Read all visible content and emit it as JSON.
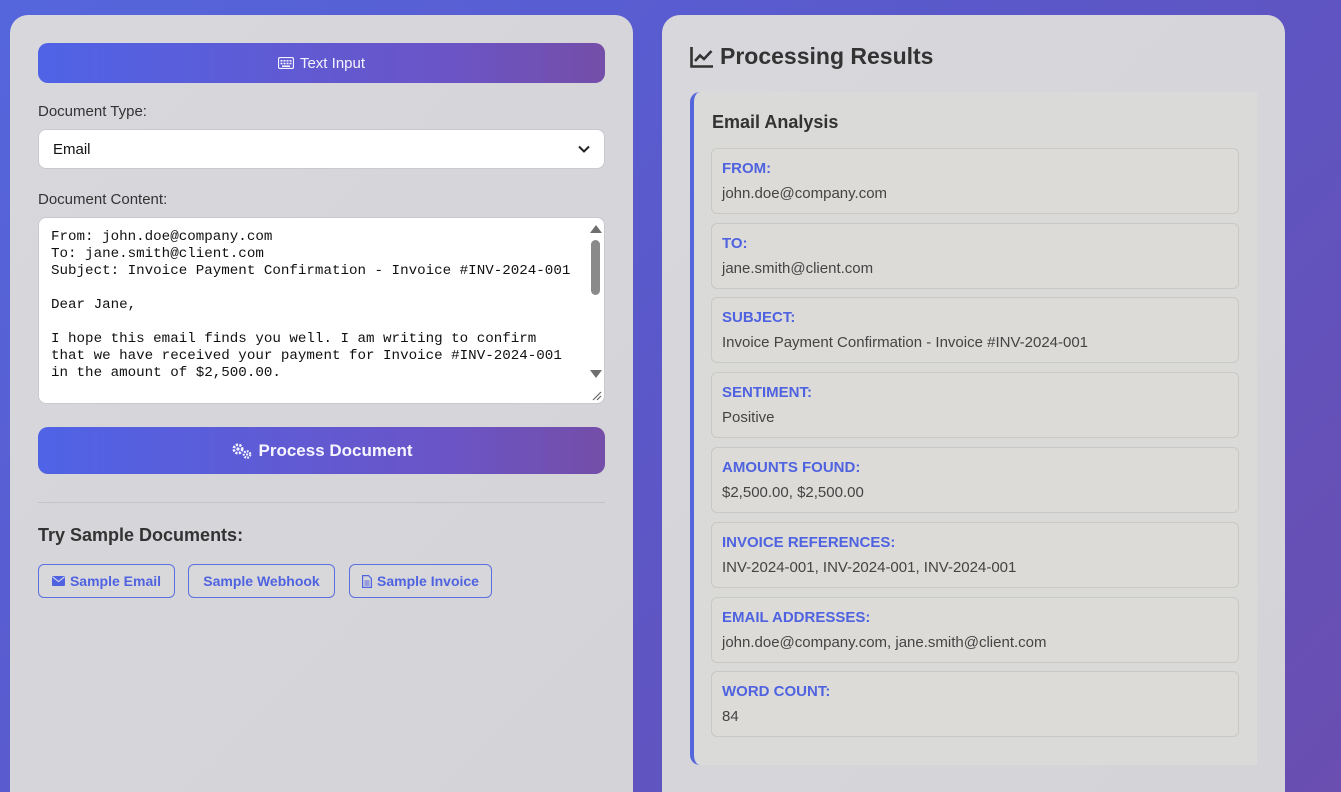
{
  "input_panel": {
    "mode_button": "Text Input",
    "document_type_label": "Document Type:",
    "document_type_selected": "Email",
    "document_content_label": "Document Content:",
    "document_content": "From: john.doe@company.com\nTo: jane.smith@client.com\nSubject: Invoice Payment Confirmation - Invoice #INV-2024-001\n\nDear Jane,\n\nI hope this email finds you well. I am writing to confirm that we have received your payment for Invoice #INV-2024-001 in the amount of $2,500.00.",
    "process_button": "Process Document",
    "samples_title": "Try Sample Documents:",
    "samples": [
      "Sample Email",
      "Sample Webhook",
      "Sample Invoice"
    ]
  },
  "results_panel": {
    "title": "Processing Results",
    "analysis_title": "Email Analysis",
    "fields": [
      {
        "label": "FROM:",
        "value": "john.doe@company.com"
      },
      {
        "label": "TO:",
        "value": "jane.smith@client.com"
      },
      {
        "label": "SUBJECT:",
        "value": "Invoice Payment Confirmation - Invoice #INV-2024-001"
      },
      {
        "label": "SENTIMENT:",
        "value": "Positive"
      },
      {
        "label": "AMOUNTS FOUND:",
        "value": "$2,500.00, $2,500.00"
      },
      {
        "label": "INVOICE REFERENCES:",
        "value": "INV-2024-001, INV-2024-001, INV-2024-001"
      },
      {
        "label": "EMAIL ADDRESSES:",
        "value": "john.doe@company.com, jane.smith@client.com"
      },
      {
        "label": "WORD COUNT:",
        "value": "84"
      }
    ]
  },
  "colors": {
    "accent": "#4f63e0",
    "gradient_start": "#4f63e6",
    "gradient_end": "#744ea8"
  },
  "icons": {
    "mode_button": "keyboard-icon",
    "process_button": "cogs-icon",
    "results_title": "chart-line-icon",
    "sample_email": "envelope-icon",
    "sample_invoice": "file-invoice-icon"
  }
}
